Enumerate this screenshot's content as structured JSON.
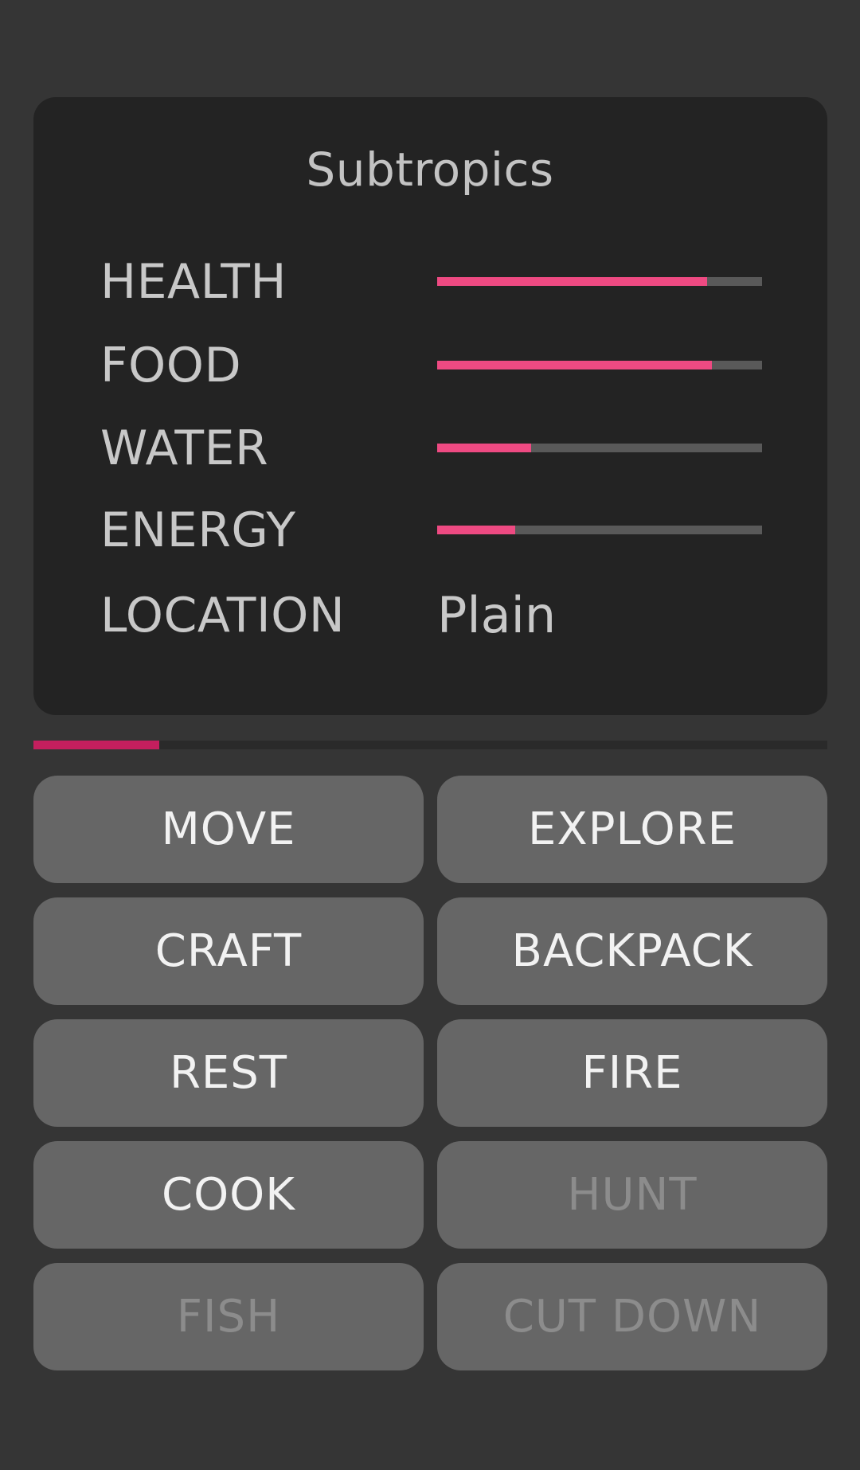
{
  "panel": {
    "title": "Subtropics"
  },
  "stats": [
    {
      "label": "HEALTH",
      "value": 0.83
    },
    {
      "label": "FOOD",
      "value": 0.845
    },
    {
      "label": "WATER",
      "value": 0.29
    },
    {
      "label": "ENERGY",
      "value": 0.24
    }
  ],
  "location": {
    "label": "LOCATION",
    "value": "Plain"
  },
  "progress": {
    "value": 0.158
  },
  "actions": [
    {
      "label": "MOVE",
      "enabled": true
    },
    {
      "label": "EXPLORE",
      "enabled": true
    },
    {
      "label": "CRAFT",
      "enabled": true
    },
    {
      "label": "BACKPACK",
      "enabled": true
    },
    {
      "label": "REST",
      "enabled": true
    },
    {
      "label": "FIRE",
      "enabled": true
    },
    {
      "label": "COOK",
      "enabled": true
    },
    {
      "label": "HUNT",
      "enabled": false
    },
    {
      "label": "FISH",
      "enabled": false
    },
    {
      "label": "CUT DOWN",
      "enabled": false
    }
  ],
  "colors": {
    "background": "#353535",
    "panel": "#232323",
    "bar_fill": "#ee4a82",
    "bar_track": "#595959",
    "progress_fill": "#c41f5e",
    "button": "#666666",
    "button_text": "#f2f2f2",
    "button_text_disabled": "#8c8c8c"
  }
}
